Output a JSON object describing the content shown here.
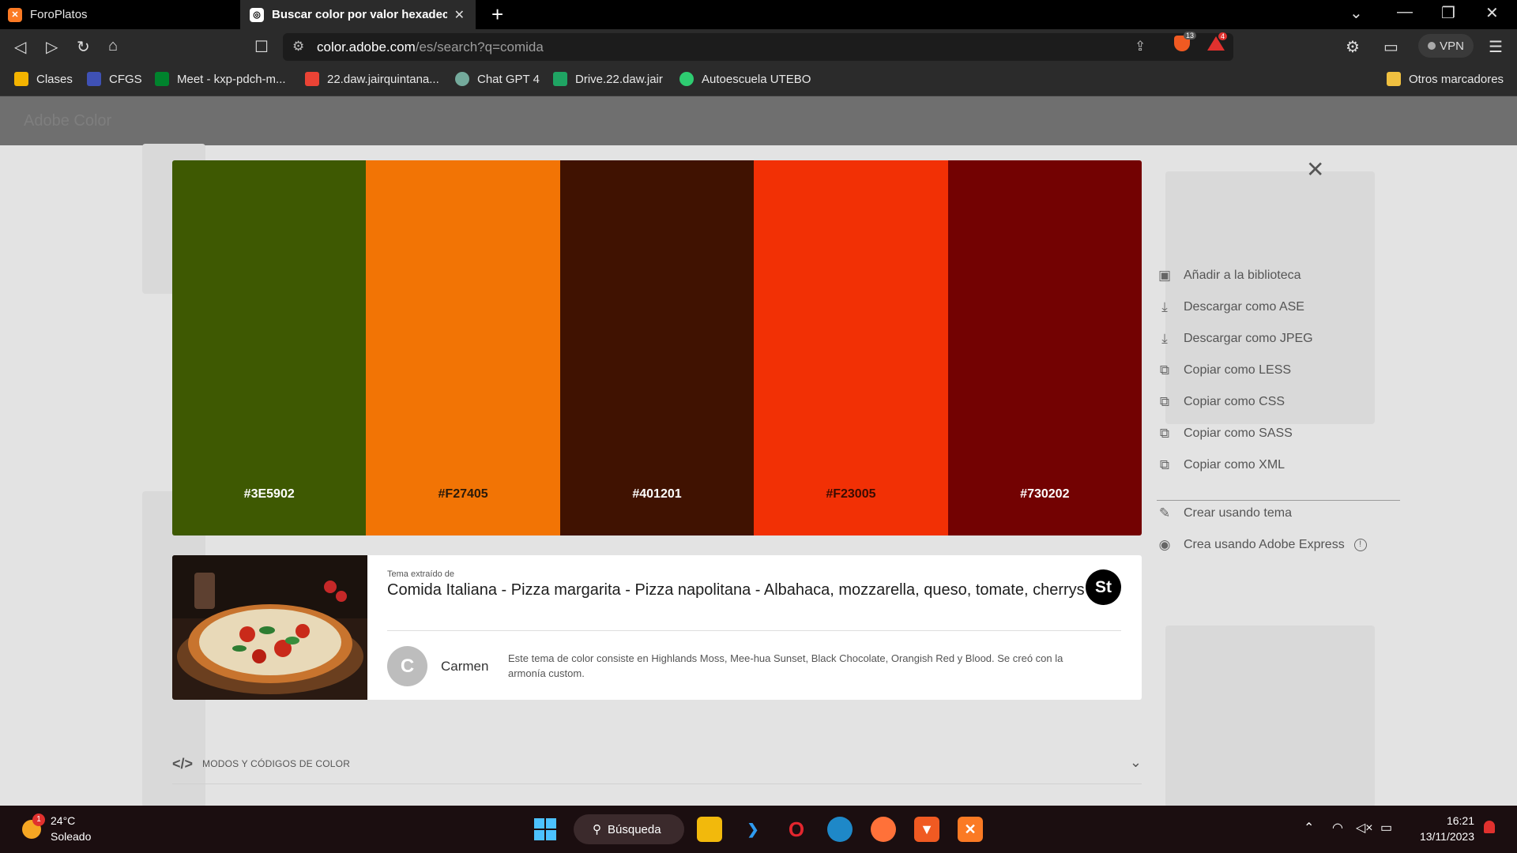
{
  "browser": {
    "tabs": [
      {
        "title": "ForoPlatos",
        "icon": "xampp-icon"
      },
      {
        "title": "Buscar color por valor hexadecimal",
        "icon": "adobe-color-icon"
      }
    ],
    "url_host": "color.adobe.com",
    "url_path": "/es/search?q=comida",
    "shield_count": "13",
    "alert_count": "4",
    "vpn_label": "VPN"
  },
  "bookmarks": {
    "items": [
      {
        "label": "Clases",
        "color": "#f4b400"
      },
      {
        "label": "CFGS",
        "color": "#3f51b5"
      },
      {
        "label": "Meet - kxp-pdch-m...",
        "color": "#00832d"
      },
      {
        "label": "22.daw.jairquintana...",
        "color": "#ea4335"
      },
      {
        "label": "Chat GPT 4",
        "color": "#74aa9c"
      },
      {
        "label": "Drive.22.daw.jair",
        "color": "#1fa463"
      },
      {
        "label": "Autoescuela UTEBO",
        "color": "#2ecc71"
      }
    ],
    "other": "Otros marcadores"
  },
  "page": {
    "logo": "Adobe Color"
  },
  "palette": {
    "swatches": [
      {
        "hex": "#3E5902",
        "label": "#3E5902",
        "text_color": "#ffffff"
      },
      {
        "hex": "#F27405",
        "label": "#F27405",
        "text_color": "#2b1a0a"
      },
      {
        "hex": "#401201",
        "label": "#401201",
        "text_color": "#ffffff"
      },
      {
        "hex": "#F23005",
        "label": "#F23005",
        "text_color": "#3a0c02"
      },
      {
        "hex": "#730202",
        "label": "#730202",
        "text_color": "#ffffff"
      }
    ]
  },
  "theme": {
    "extracted_label": "Tema extraído de",
    "title": "Comida Italiana - Pizza margarita - Pizza napolitana - Albahaca, mozzarella, queso, tomate, cherrys",
    "app_badge": "St",
    "author_initial": "C",
    "author": "Carmen",
    "description": "Este tema de color consiste en Highlands Moss, Mee-hua Sunset, Black Chocolate, Orangish Red y Blood. Se creó con la armonía custom."
  },
  "actions": {
    "items": [
      {
        "label": "Añadir a la biblioteca",
        "icon": "library-icon"
      },
      {
        "label": "Descargar como ASE",
        "icon": "download-icon"
      },
      {
        "label": "Descargar como JPEG",
        "icon": "download-icon"
      },
      {
        "label": "Copiar como LESS",
        "icon": "copy-icon"
      },
      {
        "label": "Copiar como CSS",
        "icon": "copy-icon"
      },
      {
        "label": "Copiar como SASS",
        "icon": "copy-icon"
      },
      {
        "label": "Copiar como XML",
        "icon": "copy-icon"
      }
    ],
    "create_theme": "Crear usando tema",
    "create_express": "Crea usando Adobe Express"
  },
  "modes": {
    "label": "MODOS Y CÓDIGOS DE COLOR"
  },
  "taskbar": {
    "temperature": "24°C",
    "condition": "Soleado",
    "weather_badge": "1",
    "search_label": "Búsqueda",
    "time": "16:21",
    "date": "13/11/2023"
  }
}
